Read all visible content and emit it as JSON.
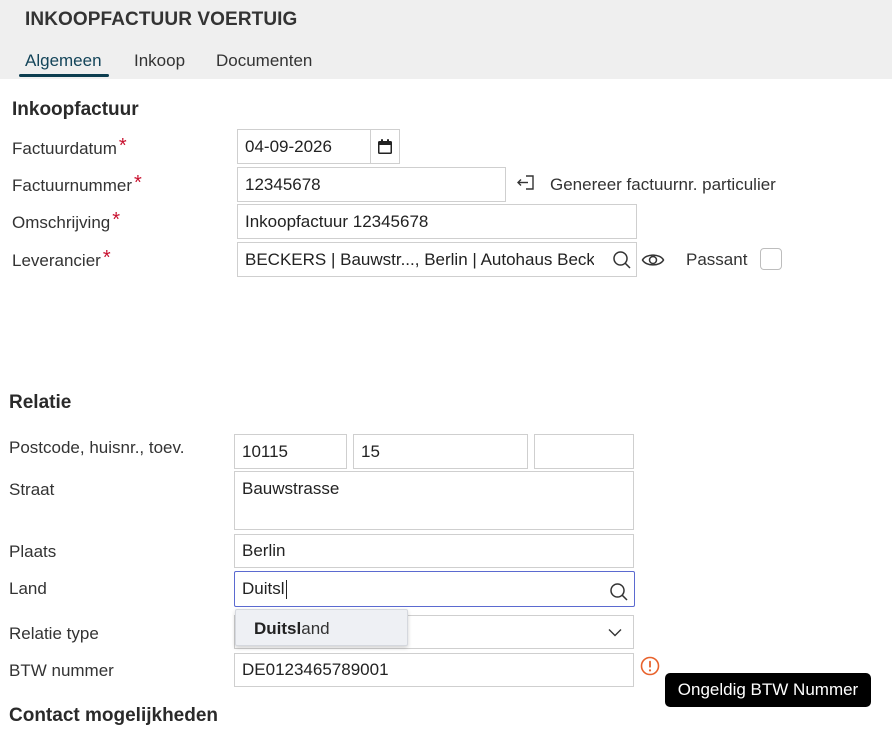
{
  "header": {
    "title": "INKOOPFACTUUR VOERTUIG",
    "tabs": [
      {
        "label": "Algemeen",
        "active": true
      },
      {
        "label": "Inkoop",
        "active": false
      },
      {
        "label": "Documenten",
        "active": false
      }
    ]
  },
  "invoice": {
    "section_title": "Inkoopfactuur",
    "invoice_date_label": "Factuurdatum",
    "invoice_date_value": "04-09-2026",
    "invoice_number_label": "Factuurnummer",
    "invoice_number_value": "12345678",
    "generate_label": "Genereer factuurnr. particulier",
    "description_label": "Omschrijving",
    "description_value": "Inkoopfactuur 12345678",
    "supplier_label": "Leverancier",
    "supplier_value": "BECKERS  | Bauwstr..., Berlin | Autohaus Becker",
    "passant_label": "Passant",
    "passant_checked": false,
    "required_marker": "*"
  },
  "relation": {
    "section_title": "Relatie",
    "postcode_label": "Postcode, huisnr., toev.",
    "postcode_value": "10115",
    "house_number_value": "15",
    "addition_value": "",
    "street_label": "Straat",
    "street_value": "Bauwstrasse",
    "city_label": "Plaats",
    "city_value": "Berlin",
    "country_label": "Land",
    "country_value": "Duitsl",
    "country_suggestion_match": "Duitsl",
    "country_suggestion_rest": "and",
    "relation_type_label": "Relatie type",
    "relation_type_value": "",
    "vat_label": "BTW nummer",
    "vat_value": "DE0123465789001",
    "vat_error_tooltip": "Ongeldig BTW Nummer"
  },
  "contact": {
    "section_title": "Contact mogelijkheden"
  },
  "colors": {
    "accent": "#0c3d4f",
    "required": "#c8102e",
    "focus_border": "#5b6ad0",
    "warning": "#e8622c"
  }
}
